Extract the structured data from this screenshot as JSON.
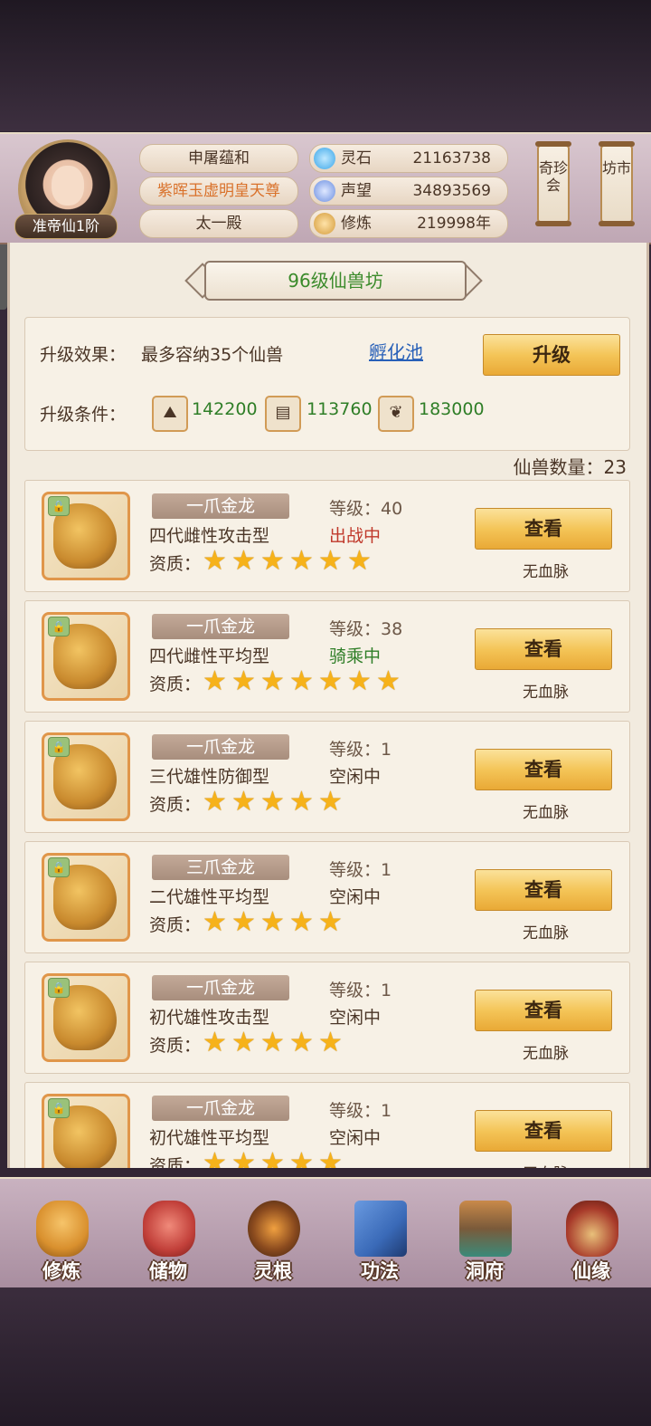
{
  "header": {
    "player_name": "申屠蕴和",
    "title": "紫晖玉虚明皇天尊",
    "sect": "太一殿",
    "rank": "准帝仙1阶",
    "resources": [
      {
        "label": "灵石",
        "value": "21163738",
        "icon": "spirit-stone-icon",
        "color": "#3aa6e8"
      },
      {
        "label": "声望",
        "value": "34893569",
        "icon": "prestige-icon",
        "color": "#6a8ee0"
      },
      {
        "label": "修炼",
        "value": "219998年",
        "icon": "cultivation-icon",
        "color": "#d39a3a"
      }
    ],
    "side_buttons": [
      "奇珍会",
      "坊市"
    ]
  },
  "panel": {
    "title": "96级仙兽坊",
    "upgrade_effect_label": "升级效果：",
    "upgrade_effect_text": "最多容纳35个仙兽",
    "hatch_link": "孵化池",
    "upgrade_button": "升级",
    "upgrade_cond_label": "升级条件：",
    "materials": [
      {
        "icon": "ore-icon",
        "value": "142200"
      },
      {
        "icon": "wood-icon",
        "value": "113760"
      },
      {
        "icon": "herb-icon",
        "value": "183000"
      }
    ],
    "count_label": "仙兽数量：",
    "count_value": "23"
  },
  "pets": [
    {
      "name": "一爪金龙",
      "level_label": "等级：",
      "level": "40",
      "type": "四代雌性攻击型",
      "state": "出战中",
      "state_color": "#c0392b",
      "apt_label": "资质：",
      "stars": 6,
      "view": "查看",
      "bloodline": "无血脉"
    },
    {
      "name": "一爪金龙",
      "level_label": "等级：",
      "level": "38",
      "type": "四代雌性平均型",
      "state": "骑乘中",
      "state_color": "#2f7e27",
      "apt_label": "资质：",
      "stars": 7,
      "view": "查看",
      "bloodline": "无血脉"
    },
    {
      "name": "一爪金龙",
      "level_label": "等级：",
      "level": "1",
      "type": "三代雄性防御型",
      "state": "空闲中",
      "state_color": "#4a3526",
      "apt_label": "资质：",
      "stars": 5,
      "view": "查看",
      "bloodline": "无血脉"
    },
    {
      "name": "三爪金龙",
      "level_label": "等级：",
      "level": "1",
      "type": "二代雄性平均型",
      "state": "空闲中",
      "state_color": "#4a3526",
      "apt_label": "资质：",
      "stars": 5,
      "view": "查看",
      "bloodline": "无血脉"
    },
    {
      "name": "一爪金龙",
      "level_label": "等级：",
      "level": "1",
      "type": "初代雄性攻击型",
      "state": "空闲中",
      "state_color": "#4a3526",
      "apt_label": "资质：",
      "stars": 5,
      "view": "查看",
      "bloodline": "无血脉"
    },
    {
      "name": "一爪金龙",
      "level_label": "等级：",
      "level": "1",
      "type": "初代雄性平均型",
      "state": "空闲中",
      "state_color": "#4a3526",
      "apt_label": "资质：",
      "stars": 5,
      "view": "查看",
      "bloodline": "无血脉"
    }
  ],
  "nav": [
    {
      "label": "修炼",
      "icon": "meditation-icon",
      "color": "#d9902e"
    },
    {
      "label": "储物",
      "icon": "storage-bag-icon",
      "color": "#c2403a"
    },
    {
      "label": "灵根",
      "icon": "spirit-root-icon",
      "color": "#8a4a1e"
    },
    {
      "label": "功法",
      "icon": "scripture-book-icon",
      "color": "#3a6ab8"
    },
    {
      "label": "洞府",
      "icon": "cave-mansion-icon",
      "color": "#7a5a3a"
    },
    {
      "label": "仙缘",
      "icon": "gourd-icon",
      "color": "#a83a2a"
    }
  ]
}
